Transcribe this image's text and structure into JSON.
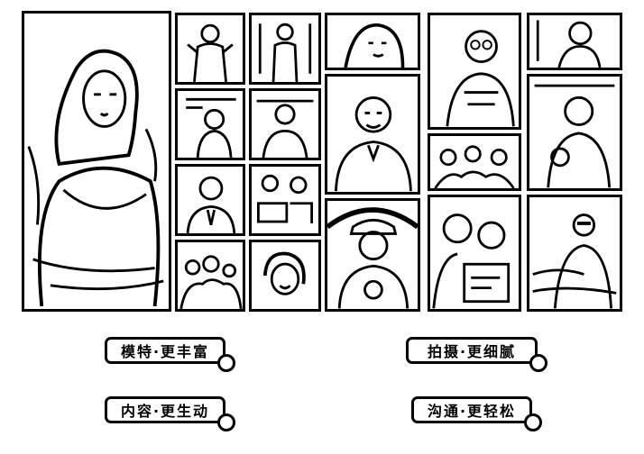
{
  "collage": {
    "tiles": [
      {
        "id": "woman-large",
        "icon": "person-portrait"
      },
      {
        "id": "man-tan-top",
        "icon": "person-portrait"
      },
      {
        "id": "woman-cafe",
        "icon": "person-portrait"
      },
      {
        "id": "man-suit",
        "icon": "person-portrait"
      },
      {
        "id": "family-group",
        "icon": "person-portrait"
      },
      {
        "id": "man-standing",
        "icon": "person-portrait"
      },
      {
        "id": "group-handshake",
        "icon": "person-portrait"
      },
      {
        "id": "woman-smiling",
        "icon": "person-portrait"
      },
      {
        "id": "woman-top-center",
        "icon": "person-portrait"
      },
      {
        "id": "man-polo",
        "icon": "person-portrait"
      },
      {
        "id": "man-cap-logo",
        "icon": "person-portrait"
      },
      {
        "id": "woman-glasses",
        "icon": "person-portrait"
      },
      {
        "id": "woman-dark-hair",
        "icon": "person-portrait"
      },
      {
        "id": "woman-sports",
        "icon": "person-portrait"
      },
      {
        "id": "children-group",
        "icon": "person-portrait"
      },
      {
        "id": "man-beach",
        "icon": "person-portrait"
      },
      {
        "id": "couple-reading",
        "icon": "person-portrait"
      },
      {
        "id": "man-sunglasses",
        "icon": "person-portrait"
      }
    ]
  },
  "tags": [
    {
      "label": "模特·更丰富"
    },
    {
      "label": "拍摄·更细腻"
    },
    {
      "label": "内容·更生动"
    },
    {
      "label": "沟通·更轻松"
    }
  ],
  "colors": {
    "ink": "#000000",
    "paper": "#ffffff"
  }
}
